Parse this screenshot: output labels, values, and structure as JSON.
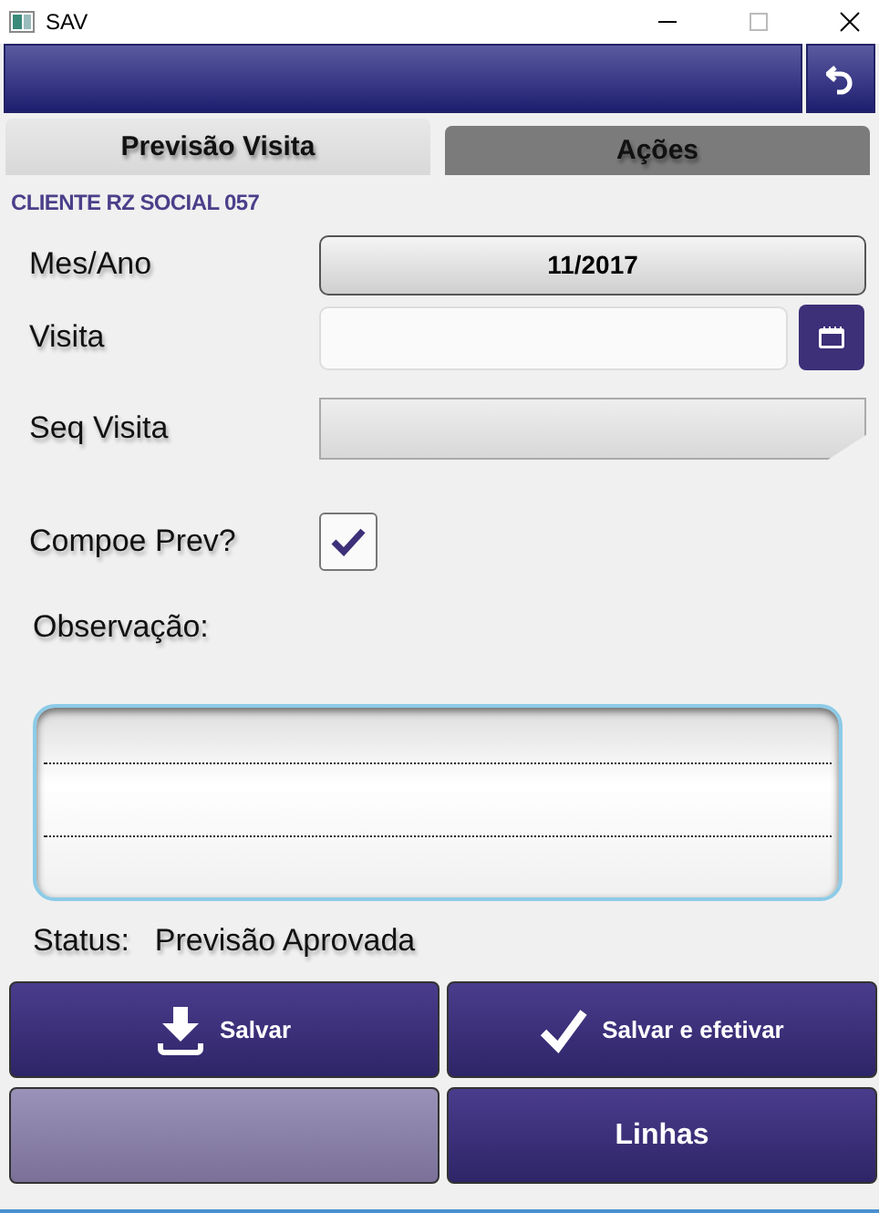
{
  "window": {
    "title": "SAV"
  },
  "tabs": [
    {
      "label": "Previsão Visita",
      "selected": true
    },
    {
      "label": "Ações",
      "selected": false
    }
  ],
  "client": "CLIENTE RZ SOCIAL 057",
  "form": {
    "mes_ano": {
      "label": "Mes/Ano",
      "value": "11/2017"
    },
    "visita": {
      "label": "Visita"
    },
    "seq_visita": {
      "label": "Seq Visita"
    },
    "compoe_prev": {
      "label": "Compoe Prev?",
      "checked": true
    },
    "observacao": {
      "label": "Observação:"
    }
  },
  "status": {
    "label": "Status:",
    "value": "Previsão Aprovada"
  },
  "buttons": [
    {
      "kind": "download",
      "label": "Salvar",
      "disabled": false
    },
    {
      "kind": "check",
      "label": "Salvar e efetivar",
      "disabled": false
    },
    {
      "kind": "none",
      "disabled": true
    },
    {
      "kind": "none",
      "label": "Linhas",
      "disabled": false
    }
  ]
}
